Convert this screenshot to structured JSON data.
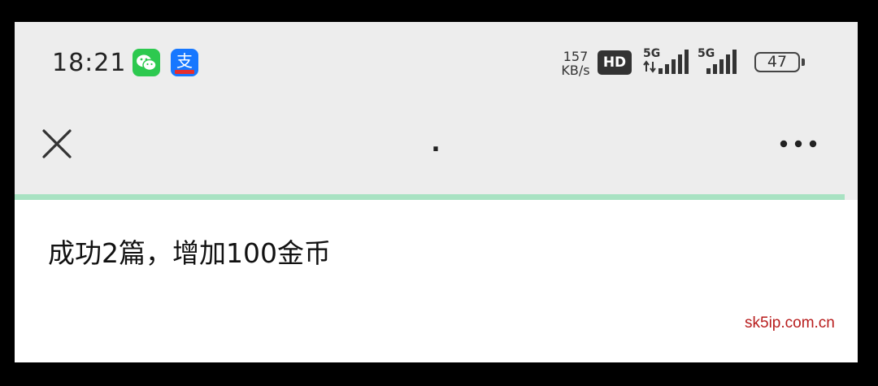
{
  "status_bar": {
    "time": "18:21",
    "apps": [
      {
        "name": "wechat-icon",
        "color": "#2dc94f"
      },
      {
        "name": "alipay-icon",
        "color": "#1677ff",
        "glyph": "支"
      }
    ],
    "net_speed_value": "157",
    "net_speed_unit": "KB/s",
    "hd_label": "HD",
    "signal_1_label": "5G",
    "signal_2_label": "5G",
    "battery_level": "47"
  },
  "nav": {
    "title": "."
  },
  "progress": {
    "fraction": 0.985,
    "color": "#a8e2c2"
  },
  "content": {
    "message": "成功2篇，增加100金币"
  },
  "watermark": "sk5ip.com.cn"
}
